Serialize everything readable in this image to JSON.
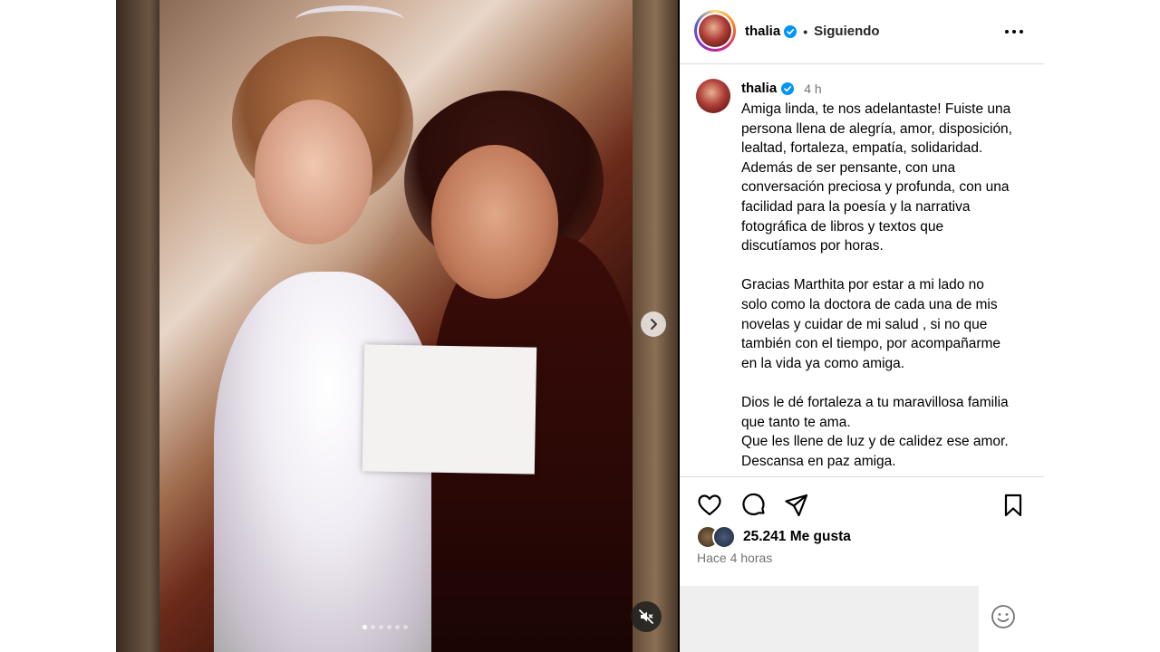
{
  "post": {
    "username": "thalia",
    "follow_status": "Siguiendo",
    "separator": "•",
    "time_short": "4 h",
    "caption": "Amiga linda, te nos adelantaste! Fuiste una persona llena de alegría, amor, disposición, lealtad, fortaleza, empatía, solidaridad.\nAdemás de ser pensante, con una conversación preciosa y profunda, con una facilidad para la poesía y la narrativa fotográfica de libros y textos que discutíamos por horas.\n\nGracias Marthita por estar a mi lado no solo como la doctora de cada una de mis novelas y cuidar de mi salud , si no que también con el tiempo, por acompañarme en la vida ya como amiga.\n\nDios le dé fortaleza a tu maravillosa familia que tanto te ama.\nQue les llene de luz y de calidez ese amor. Descansa en paz amiga.",
    "likes": "25.241 Me gusta",
    "time_long": "Hace 4 horas",
    "comment_placeholder": ""
  },
  "carousel": {
    "slide_count": 6,
    "active_index": 0
  },
  "icons": {
    "verified": "verified-badge-icon",
    "more": "more-options-icon",
    "next": "chevron-right-icon",
    "mute": "muted-audio-icon",
    "like": "heart-icon",
    "comment": "comment-bubble-icon",
    "share": "paper-plane-icon",
    "save": "bookmark-icon",
    "emoji": "smiley-icon"
  },
  "colors": {
    "verified": "#0095f6",
    "muted_text": "#737373",
    "border": "#dbdbdb"
  }
}
